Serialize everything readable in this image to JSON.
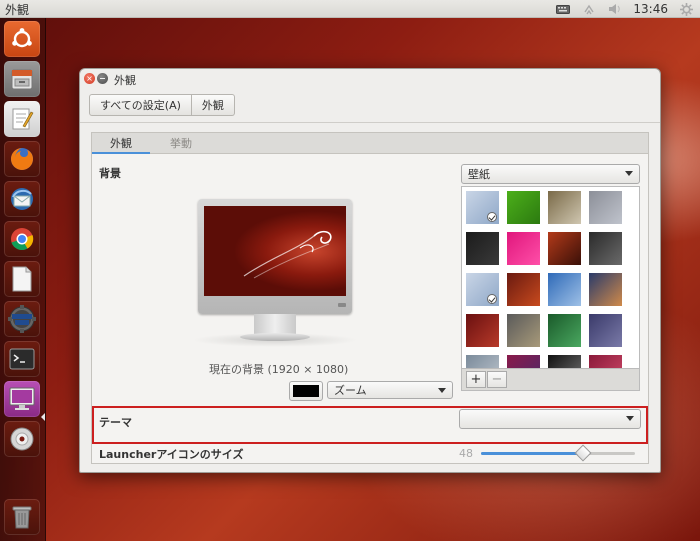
{
  "top_panel": {
    "app_title": "外観",
    "clock": "13:46",
    "icons": [
      "keyboard-icon",
      "network-icon",
      "volume-icon",
      "settings-gear-icon"
    ]
  },
  "launcher": {
    "items": [
      {
        "name": "ubuntu-dash",
        "color": "#d9541e"
      },
      {
        "name": "files",
        "color": "#8a8a8a"
      },
      {
        "name": "text-editor",
        "color": "#d8d8d8"
      },
      {
        "name": "firefox",
        "color": "#e66000"
      },
      {
        "name": "thunderbird",
        "color": "#2c6ab0"
      },
      {
        "name": "chrome",
        "color": "#34a853"
      },
      {
        "name": "libreoffice",
        "color": "#e8e8e8"
      },
      {
        "name": "lazarus-ide",
        "color": "#555555",
        "label": "Lazarus IDE"
      },
      {
        "name": "terminal",
        "color": "#2b2b2b"
      },
      {
        "name": "system-settings",
        "color": "#a23ea0"
      },
      {
        "name": "dvd-drive",
        "color": "#cccccc"
      },
      {
        "name": "trash",
        "color": "#888888"
      }
    ]
  },
  "window": {
    "title": "外観",
    "breadcrumbs": [
      "すべての設定(A)",
      "外観"
    ],
    "tabs": [
      {
        "label": "外観",
        "active": true
      },
      {
        "label": "挙動",
        "active": false
      }
    ],
    "background_label": "背景",
    "current_background": "現在の背景 (1920 × 1080)",
    "color_value": "#000000",
    "zoom_value": "ズーム",
    "wallpaper_select": "壁紙",
    "wallpapers": [
      {
        "id": "w1",
        "colors": [
          "#c9d5e6",
          "#8fa8c8"
        ],
        "selected": true
      },
      {
        "id": "w2",
        "colors": [
          "#4caf1a",
          "#2c7a10"
        ]
      },
      {
        "id": "w3",
        "colors": [
          "#7a6a48",
          "#cfc6b0"
        ]
      },
      {
        "id": "w4",
        "colors": [
          "#8c8f98",
          "#bfc3cc"
        ]
      },
      {
        "id": "w5",
        "colors": [
          "#1b1b1b",
          "#3a3a3a"
        ]
      },
      {
        "id": "w6",
        "colors": [
          "#e0167c",
          "#ff4fa8"
        ]
      },
      {
        "id": "w7",
        "colors": [
          "#b33a1a",
          "#3a1008"
        ]
      },
      {
        "id": "w8",
        "colors": [
          "#2a2a2a",
          "#6a6a6a"
        ]
      },
      {
        "id": "w9",
        "colors": [
          "#c9d5e6",
          "#8fa8c8"
        ],
        "selected": true
      },
      {
        "id": "w10",
        "colors": [
          "#6a1a10",
          "#c84a1e"
        ]
      },
      {
        "id": "w11",
        "colors": [
          "#2f6ab8",
          "#9ec0e6"
        ]
      },
      {
        "id": "w12",
        "colors": [
          "#2a3b6a",
          "#d08a4a"
        ]
      },
      {
        "id": "w13",
        "colors": [
          "#6a1010",
          "#b83a2a"
        ]
      },
      {
        "id": "w14",
        "colors": [
          "#5a5a5a",
          "#a89a7a"
        ]
      },
      {
        "id": "w15",
        "colors": [
          "#1a5a2a",
          "#4aa860"
        ]
      },
      {
        "id": "w16",
        "colors": [
          "#3a3a6a",
          "#7a7aa8"
        ]
      },
      {
        "id": "w17",
        "colors": [
          "#7a8a9a",
          "#c0c8d0"
        ]
      },
      {
        "id": "w18",
        "colors": [
          "#8a1a4a",
          "#4a2a6a"
        ]
      },
      {
        "id": "w19",
        "colors": [
          "#111111",
          "#777777"
        ]
      },
      {
        "id": "w20",
        "colors": [
          "#8a1a3a",
          "#d04a6a"
        ]
      }
    ],
    "add_label": "+",
    "remove_label": "−",
    "theme_label": "テーマ",
    "theme_value": "",
    "launcher_size_label": "Launcherアイコンのサイズ",
    "launcher_size_value": "48",
    "launcher_size_fraction": 0.66
  }
}
